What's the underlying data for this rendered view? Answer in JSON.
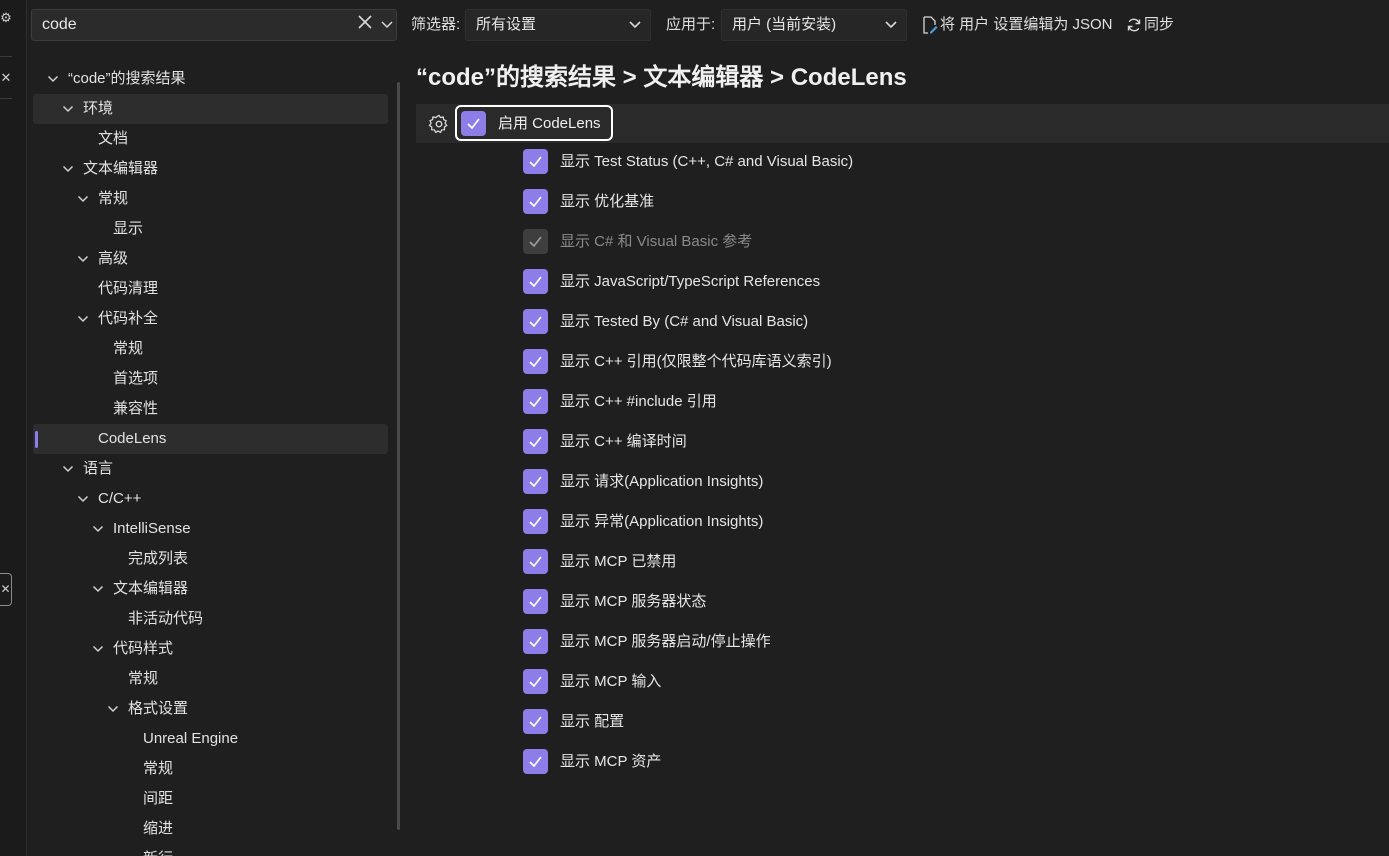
{
  "toolbar": {
    "search_value": "code",
    "filter_label": "筛选器:",
    "filter_value": "所有设置",
    "apply_label": "应用于:",
    "apply_value": "用户 (当前安装)",
    "edit_json_label": "将 用户 设置编辑为 JSON",
    "sync_label": "同步"
  },
  "tree": {
    "items": [
      {
        "label": "“code”的搜索结果",
        "level": 0,
        "expanded": true
      },
      {
        "label": "环境",
        "level": 1,
        "expanded": true
      },
      {
        "label": "文档",
        "level": 2
      },
      {
        "label": "文本编辑器",
        "level": 1,
        "expanded": true
      },
      {
        "label": "常规",
        "level": 2,
        "expanded": true
      },
      {
        "label": "显示",
        "level": 3
      },
      {
        "label": "高级",
        "level": 2,
        "expanded": true
      },
      {
        "label": "代码清理",
        "level": 2
      },
      {
        "label": "代码补全",
        "level": 2,
        "expanded": true
      },
      {
        "label": "常规",
        "level": 3
      },
      {
        "label": "首选项",
        "level": 3
      },
      {
        "label": "兼容性",
        "level": 3
      },
      {
        "label": "CodeLens",
        "level": 2,
        "selected": true
      },
      {
        "label": "语言",
        "level": 1,
        "expanded": true
      },
      {
        "label": "C/C++",
        "level": 2,
        "expanded": true
      },
      {
        "label": "IntelliSense",
        "level": 3,
        "expanded": true
      },
      {
        "label": "完成列表",
        "level": 4
      },
      {
        "label": "文本编辑器",
        "level": 3,
        "expanded": true
      },
      {
        "label": "非活动代码",
        "level": 4
      },
      {
        "label": "代码样式",
        "level": 3,
        "expanded": true
      },
      {
        "label": "常规",
        "level": 4
      },
      {
        "label": "格式设置",
        "level": 4,
        "expanded": true
      },
      {
        "label": "Unreal Engine",
        "level": 5
      },
      {
        "label": "常规",
        "level": 5
      },
      {
        "label": "间距",
        "level": 5
      },
      {
        "label": "缩进",
        "level": 5
      },
      {
        "label": "新行",
        "level": 5
      }
    ]
  },
  "content": {
    "title": "“code”的搜索结果 > 文本编辑器 > CodeLens",
    "master": {
      "label": "启用 CodeLens",
      "checked": true
    },
    "options": [
      {
        "label": "显示 Test Status (C++, C# and Visual Basic)",
        "checked": true,
        "disabled": false
      },
      {
        "label": "显示 优化基准",
        "checked": true,
        "disabled": false
      },
      {
        "label": "显示 C# 和 Visual Basic 参考",
        "checked": true,
        "disabled": true
      },
      {
        "label": "显示 JavaScript/TypeScript References",
        "checked": true,
        "disabled": false
      },
      {
        "label": "显示 Tested By (C# and Visual Basic)",
        "checked": true,
        "disabled": false
      },
      {
        "label": "显示 C++ 引用(仅限整个代码库语义索引)",
        "checked": true,
        "disabled": false
      },
      {
        "label": "显示 C++ #include 引用",
        "checked": true,
        "disabled": false
      },
      {
        "label": "显示 C++ 编译时间",
        "checked": true,
        "disabled": false
      },
      {
        "label": "显示 请求(Application Insights)",
        "checked": true,
        "disabled": false
      },
      {
        "label": "显示 异常(Application Insights)",
        "checked": true,
        "disabled": false
      },
      {
        "label": "显示 MCP 已禁用",
        "checked": true,
        "disabled": false
      },
      {
        "label": "显示 MCP 服务器状态",
        "checked": true,
        "disabled": false
      },
      {
        "label": "显示 MCP 服务器启动/停止操作",
        "checked": true,
        "disabled": false
      },
      {
        "label": "显示 MCP 输入",
        "checked": true,
        "disabled": false
      },
      {
        "label": "显示 配置",
        "checked": true,
        "disabled": false
      },
      {
        "label": "显示 MCP 资产",
        "checked": true,
        "disabled": false
      }
    ]
  },
  "colors": {
    "accent": "#8c7de8",
    "background": "#1f1f1f",
    "disabled_checkbox": "#3e3e3e"
  },
  "icons": {
    "clear": "close-icon",
    "search_history": "chevron-down-icon",
    "edit_json": "edit-file-icon",
    "sync": "sync-icon",
    "settings": "gear-icon"
  }
}
